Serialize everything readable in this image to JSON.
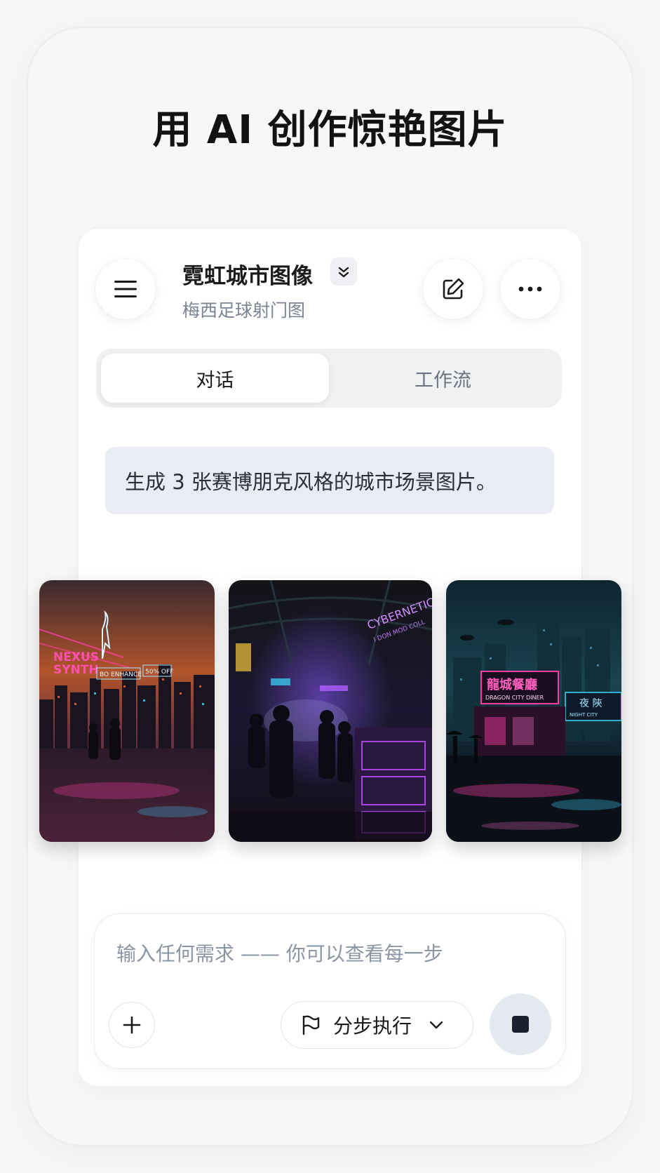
{
  "hero": {
    "title": "用 AI 创作惊艳图片"
  },
  "header": {
    "title": "霓虹城市图像",
    "subtitle": "梅西足球射门图",
    "menu_icon": "menu-icon",
    "edit_icon": "edit-icon",
    "more_icon": "more-icon"
  },
  "tabs": [
    {
      "label": "对话",
      "active": true
    },
    {
      "label": "工作流",
      "active": false
    }
  ],
  "chat": {
    "user_message": "生成 3 张赛博朋克风格的城市场景图片。"
  },
  "images": [
    {
      "id": "nexus",
      "signs": {
        "line1": "NEXUS",
        "line2": "SYNTH",
        "banner1": "BO ENHANCE",
        "banner2": "50% OFF"
      }
    },
    {
      "id": "cybernetics",
      "signs": {
        "line1": "CYBERNETICS",
        "line2": "I DON MOD COLL"
      }
    },
    {
      "id": "dragon",
      "signs": {
        "line1": "龍城餐廳",
        "line2": "DRAGON CITY DINER",
        "side1": "夜 陝",
        "side2": "NIGHT CITY"
      }
    }
  ],
  "composer": {
    "placeholder": "输入任何需求 —— 你可以查看每一步",
    "mode_label": "分步执行",
    "plus_icon": "plus-icon",
    "flag_icon": "flag-icon",
    "stop_icon": "stop-icon"
  },
  "colors": {
    "accent_bubble": "#e9edf3",
    "stop_button": "#e4e9f0",
    "neon_pink": "#ff3ea5",
    "neon_cyan": "#3ad9ff"
  }
}
